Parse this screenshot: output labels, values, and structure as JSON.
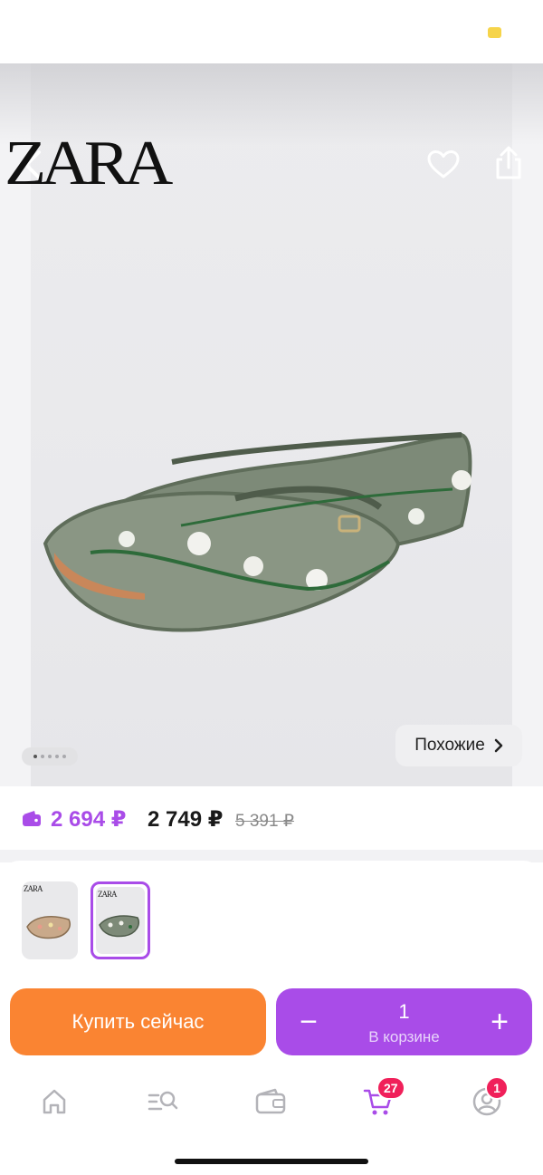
{
  "hero": {
    "brand_logo": "ZARA",
    "similar_label": "Похожие",
    "image_count": 5,
    "active_image": 1
  },
  "price": {
    "wallet_price": "2 694 ₽",
    "price": "2 749 ₽",
    "old_price": "5 391 ₽"
  },
  "variants": [
    {
      "logo": "ZARA",
      "selected": false
    },
    {
      "logo": "ZARA",
      "selected": true
    }
  ],
  "actions": {
    "buy_now": "Купить сейчас",
    "quantity": "1",
    "in_cart_label": "В корзине",
    "minus": "−",
    "plus": "+"
  },
  "tabbar": {
    "items": [
      {
        "icon": "home-icon"
      },
      {
        "icon": "catalog-search-icon"
      },
      {
        "icon": "wallet-icon"
      },
      {
        "icon": "cart-icon",
        "badge": "27",
        "active": true
      },
      {
        "icon": "profile-icon",
        "badge": "1"
      }
    ]
  },
  "colors": {
    "accent": "#a94ce8",
    "buy": "#fa8432",
    "badge": "#f0205a"
  }
}
